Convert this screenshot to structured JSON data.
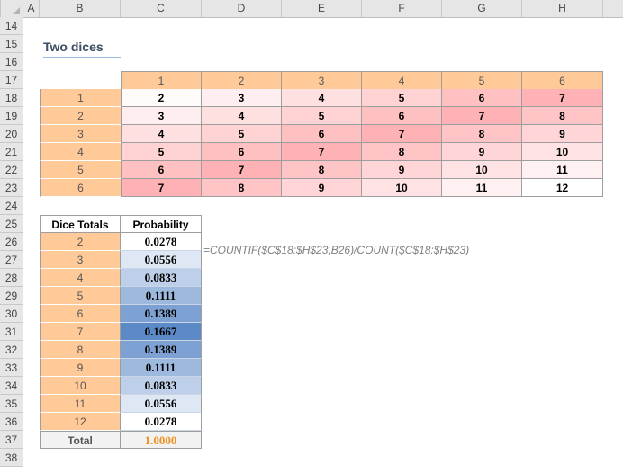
{
  "columns": [
    "A",
    "B",
    "C",
    "D",
    "E",
    "F",
    "G",
    "H"
  ],
  "rows": [
    "14",
    "15",
    "16",
    "17",
    "18",
    "19",
    "20",
    "21",
    "22",
    "23",
    "24",
    "25",
    "26",
    "27",
    "28",
    "29",
    "30",
    "31",
    "32",
    "33",
    "34",
    "35",
    "36",
    "37",
    "38"
  ],
  "title": "Two dices",
  "top_header": [
    "1",
    "2",
    "3",
    "4",
    "5",
    "6"
  ],
  "left_header": [
    "1",
    "2",
    "3",
    "4",
    "5",
    "6"
  ],
  "dice_grid": [
    [
      "2",
      "3",
      "4",
      "5",
      "6",
      "7"
    ],
    [
      "3",
      "4",
      "5",
      "6",
      "7",
      "8"
    ],
    [
      "4",
      "5",
      "6",
      "7",
      "8",
      "9"
    ],
    [
      "5",
      "6",
      "7",
      "8",
      "9",
      "10"
    ],
    [
      "6",
      "7",
      "8",
      "9",
      "10",
      "11"
    ],
    [
      "7",
      "8",
      "9",
      "10",
      "11",
      "12"
    ]
  ],
  "prob_table": {
    "col1_header": "Dice Totals",
    "col2_header": "Probability",
    "rows": [
      {
        "total": "2",
        "prob": "0.0278"
      },
      {
        "total": "3",
        "prob": "0.0556"
      },
      {
        "total": "4",
        "prob": "0.0833"
      },
      {
        "total": "5",
        "prob": "0.1111"
      },
      {
        "total": "6",
        "prob": "0.1389"
      },
      {
        "total": "7",
        "prob": "0.1667"
      },
      {
        "total": "8",
        "prob": "0.1389"
      },
      {
        "total": "9",
        "prob": "0.1111"
      },
      {
        "total": "10",
        "prob": "0.0833"
      },
      {
        "total": "11",
        "prob": "0.0556"
      },
      {
        "total": "12",
        "prob": "0.0278"
      }
    ],
    "total_label": "Total",
    "total_value": "1.0000"
  },
  "formula": "=COUNTIF($C$18:$H$23,B26)/COUNT($C$18:$H$23)",
  "colors": {
    "orange": "#ffc998",
    "total_value": "#f0901e"
  }
}
